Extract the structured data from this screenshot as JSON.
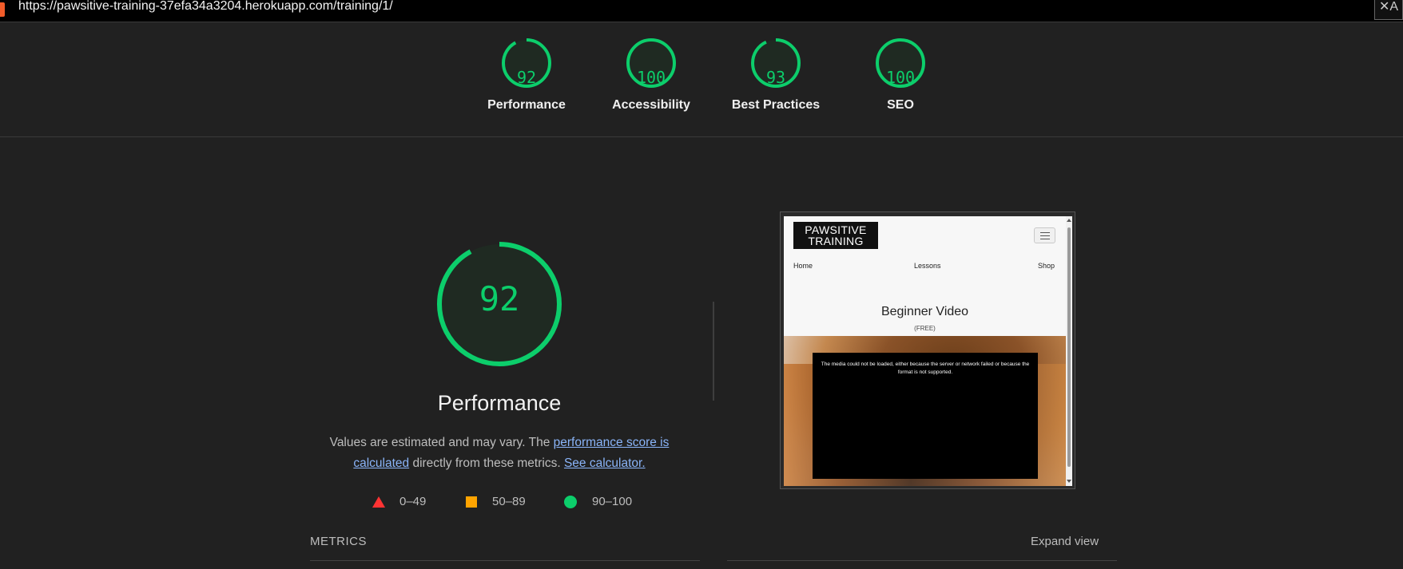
{
  "browser": {
    "url": "https://pawsitive-training-37efa34a3204.herokuapp.com/training/1/",
    "translate_icon": "translate-icon"
  },
  "gauges": [
    {
      "score": "92",
      "label": "Performance"
    },
    {
      "score": "100",
      "label": "Accessibility"
    },
    {
      "score": "93",
      "label": "Best Practices"
    },
    {
      "score": "100",
      "label": "SEO"
    }
  ],
  "performance": {
    "score": "92",
    "title": "Performance",
    "desc_prefix": "Values are estimated and may vary. The ",
    "desc_link": "performance score is calculated",
    "desc_middle": " directly from these metrics.",
    "calc_link": "See calculator."
  },
  "legend": [
    {
      "range": "0–49",
      "icon": "triangle-icon",
      "color": "#ff3333"
    },
    {
      "range": "50–89",
      "icon": "square-icon",
      "color": "#ffa400"
    },
    {
      "range": "90–100",
      "icon": "circle-icon",
      "color": "#0cce6b"
    }
  ],
  "preview": {
    "logo": "PAWSITIVE TRAINING",
    "nav": [
      "Home",
      "Lessons",
      "Shop"
    ],
    "title": "Beginner Video",
    "subtitle": "(FREE)",
    "video_error": "The media could not be loaded, either because the server or network failed or because the format is not supported."
  },
  "metrics": {
    "label": "METRICS",
    "expand": "Expand view"
  },
  "colors": {
    "pass": "#0cce6b",
    "average": "#ffa400",
    "fail": "#ff3333",
    "background": "#212121"
  }
}
